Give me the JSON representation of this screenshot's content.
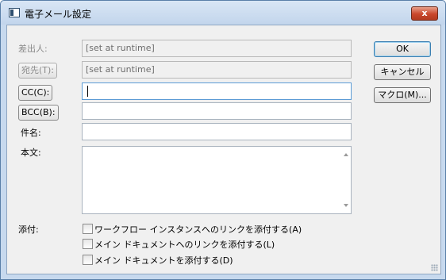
{
  "window": {
    "title": "電子メール設定",
    "close_label": "x"
  },
  "form": {
    "from_label": "差出人:",
    "from_value": "[set at runtime]",
    "to_label": "宛先(T):",
    "to_value": "[set at runtime]",
    "cc_label": "CC(C):",
    "cc_value": "",
    "bcc_label": "BCC(B):",
    "bcc_value": "",
    "subject_label": "件名:",
    "subject_value": "",
    "body_label": "本文:",
    "attach_label": "添付:",
    "attachments": [
      {
        "label": "ワークフロー インスタンスへのリンクを添付する(A)",
        "checked": false
      },
      {
        "label": "メイン ドキュメントへのリンクを添付する(L)",
        "checked": false
      },
      {
        "label": "メイン ドキュメントを添付する(D)",
        "checked": false
      }
    ]
  },
  "buttons": {
    "ok": "OK",
    "cancel": "キャンセル",
    "macro": "マクロ(M)..."
  }
}
